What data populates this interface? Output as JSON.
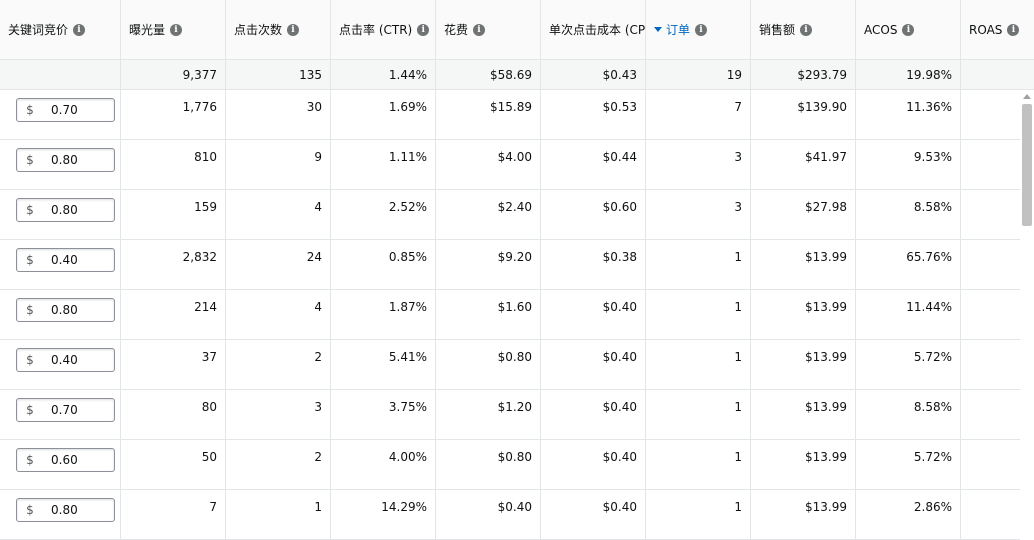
{
  "columns": [
    {
      "label": "关键词竞价",
      "sorted": false
    },
    {
      "label": "曝光量",
      "sorted": false
    },
    {
      "label": "点击次数",
      "sorted": false
    },
    {
      "label": "点击率 (CTR)",
      "sorted": false
    },
    {
      "label": "花费",
      "sorted": false
    },
    {
      "label": "单次点击成本 (CPC)",
      "sorted": false
    },
    {
      "label": "订单",
      "sorted": true
    },
    {
      "label": "销售额",
      "sorted": false
    },
    {
      "label": "ACOS",
      "sorted": false
    },
    {
      "label": "ROAS",
      "sorted": false
    }
  ],
  "totals": [
    "",
    "9,377",
    "135",
    "1.44%",
    "$58.69",
    "$0.43",
    "19",
    "$293.79",
    "19.98%",
    "$"
  ],
  "bid_currency": "$",
  "rows": [
    {
      "bid": "0.70",
      "impressions": "1,776",
      "clicks": "30",
      "ctr": "1.69%",
      "spend": "$15.89",
      "cpc": "$0.53",
      "orders": "7",
      "sales": "$139.90",
      "acos": "11.36%"
    },
    {
      "bid": "0.80",
      "impressions": "810",
      "clicks": "9",
      "ctr": "1.11%",
      "spend": "$4.00",
      "cpc": "$0.44",
      "orders": "3",
      "sales": "$41.97",
      "acos": "9.53%"
    },
    {
      "bid": "0.80",
      "impressions": "159",
      "clicks": "4",
      "ctr": "2.52%",
      "spend": "$2.40",
      "cpc": "$0.60",
      "orders": "3",
      "sales": "$27.98",
      "acos": "8.58%"
    },
    {
      "bid": "0.40",
      "impressions": "2,832",
      "clicks": "24",
      "ctr": "0.85%",
      "spend": "$9.20",
      "cpc": "$0.38",
      "orders": "1",
      "sales": "$13.99",
      "acos": "65.76%"
    },
    {
      "bid": "0.80",
      "impressions": "214",
      "clicks": "4",
      "ctr": "1.87%",
      "spend": "$1.60",
      "cpc": "$0.40",
      "orders": "1",
      "sales": "$13.99",
      "acos": "11.44%"
    },
    {
      "bid": "0.40",
      "impressions": "37",
      "clicks": "2",
      "ctr": "5.41%",
      "spend": "$0.80",
      "cpc": "$0.40",
      "orders": "1",
      "sales": "$13.99",
      "acos": "5.72%"
    },
    {
      "bid": "0.70",
      "impressions": "80",
      "clicks": "3",
      "ctr": "3.75%",
      "spend": "$1.20",
      "cpc": "$0.40",
      "orders": "1",
      "sales": "$13.99",
      "acos": "8.58%"
    },
    {
      "bid": "0.60",
      "impressions": "50",
      "clicks": "2",
      "ctr": "4.00%",
      "spend": "$0.80",
      "cpc": "$0.40",
      "orders": "1",
      "sales": "$13.99",
      "acos": "5.72%"
    },
    {
      "bid": "0.80",
      "impressions": "7",
      "clicks": "1",
      "ctr": "14.29%",
      "spend": "$0.40",
      "cpc": "$0.40",
      "orders": "1",
      "sales": "$13.99",
      "acos": "2.86%"
    }
  ]
}
